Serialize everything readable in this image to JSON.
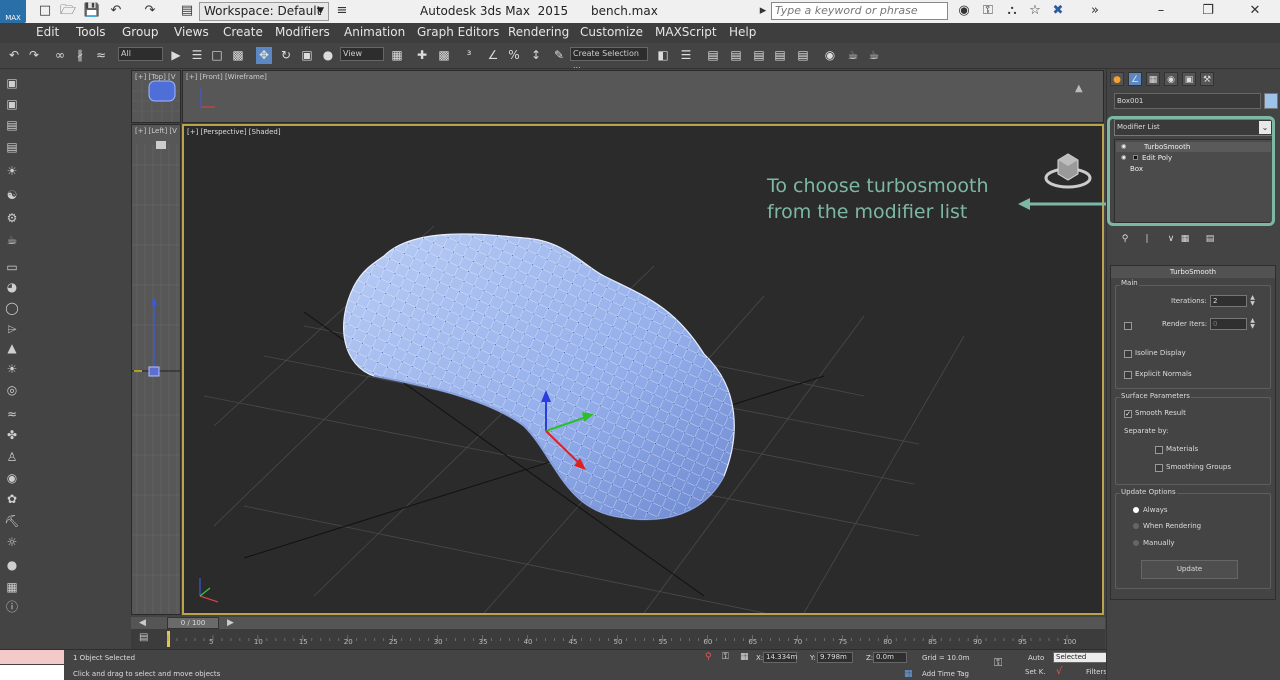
{
  "title_bar": {
    "logo": "MAX",
    "workspace": "Workspace: Default",
    "app_title": "Autodesk 3ds Max  2015      bench.max",
    "search_placeholder": "Type a keyword or phrase"
  },
  "menu": [
    "Edit",
    "Tools",
    "Group",
    "Views",
    "Create",
    "Modifiers",
    "Animation",
    "Graph Editors",
    "Rendering",
    "Customize",
    "MAXScript",
    "Help"
  ],
  "toolbar": {
    "filter_select": "All",
    "reference_coord": "View",
    "named_selection": "Create Selection ..."
  },
  "viewports": {
    "top_label": "[+] [Top] [V",
    "front_label": "[+] [Front] [Wireframe]",
    "left_label": "[+] [Left] [V",
    "perspective_label": "[+] [Perspective] [Shaded]"
  },
  "timeline": {
    "slider": "0 / 100",
    "ticks": [
      "5",
      "10",
      "15",
      "20",
      "25",
      "30",
      "35",
      "40",
      "45",
      "50",
      "55",
      "60",
      "65",
      "70",
      "75",
      "80",
      "85",
      "90",
      "95",
      "100"
    ]
  },
  "status": {
    "selection": "1 Object Selected",
    "prompt": "Click and drag to select and move objects",
    "x_label": "X:",
    "x_value": "14.334m",
    "y_label": "Y:",
    "y_value": "9.798m",
    "z_label": "Z:",
    "z_value": "0.0m",
    "grid": "Grid = 10.0m",
    "add_time_tag": "Add Time Tag",
    "auto": "Auto",
    "selected": "Selected",
    "set_k": "Set K.",
    "filters": "Filters..."
  },
  "command_panel": {
    "object_name": "Box001",
    "color": "#9dc3e8",
    "modifier_list": "Modifier List",
    "stack": [
      "TurboSmooth",
      "Edit Poly",
      "Box"
    ]
  },
  "annotation": "To choose turbosmooth\nfrom the modifier list",
  "turbosmooth": {
    "title": "TurboSmooth",
    "main_group": "Main",
    "iterations_label": "Iterations:",
    "iterations_value": "2",
    "render_iters_label": "Render Iters:",
    "render_iters_value": "0",
    "isoline_display": "Isoline Display",
    "explicit_normals": "Explicit Normals",
    "surface_group": "Surface Parameters",
    "smooth_result": "Smooth Result",
    "separate_by": "Separate by:",
    "materials": "Materials",
    "smoothing_groups": "Smoothing Groups",
    "update_group": "Update Options",
    "always": "Always",
    "when_rendering": "When Rendering",
    "manually": "Manually",
    "update_button": "Update"
  }
}
